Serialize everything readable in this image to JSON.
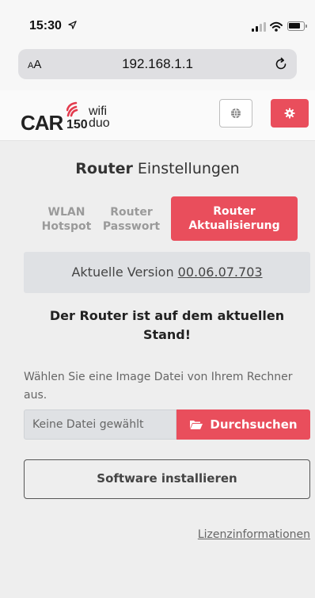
{
  "status_bar": {
    "time": "15:30",
    "location_icon": "location-arrow-icon",
    "signal_icon": "cellular-signal-icon",
    "wifi_icon": "wifi-icon",
    "battery_icon": "battery-icon"
  },
  "browser": {
    "text_size_small": "A",
    "text_size_large": "A",
    "url": "192.168.1.1",
    "reload_icon": "reload-icon"
  },
  "header": {
    "logo": {
      "brand": "CAR",
      "number": "150",
      "wifi": "wifi",
      "duo": "duo"
    },
    "language_icon": "globe-icon",
    "settings_icon": "gear-icon",
    "accent_color": "#e94e5c"
  },
  "page": {
    "title_bold": "Router",
    "title_rest": " Einstellungen",
    "tabs": [
      {
        "line1": "WLAN",
        "line2": "Hotspot",
        "active": false
      },
      {
        "line1": "Router",
        "line2": "Passwort",
        "active": false
      },
      {
        "line1": "Router",
        "line2": "Aktualisierung",
        "active": true
      }
    ],
    "version_label": "Aktuelle Version ",
    "version_value": "00.06.07.703",
    "status_line1": "Der Router ist auf dem aktuellen",
    "status_line2": "Stand!",
    "file_hint": "Wählen Sie eine Image Datei von Ihrem Rechner aus.",
    "file_placeholder": "Keine Datei gewählt",
    "browse_label": "Durchsuchen",
    "browse_icon": "folder-open-icon",
    "install_label": "Software installieren",
    "license_link": "Lizenzinformationen"
  }
}
